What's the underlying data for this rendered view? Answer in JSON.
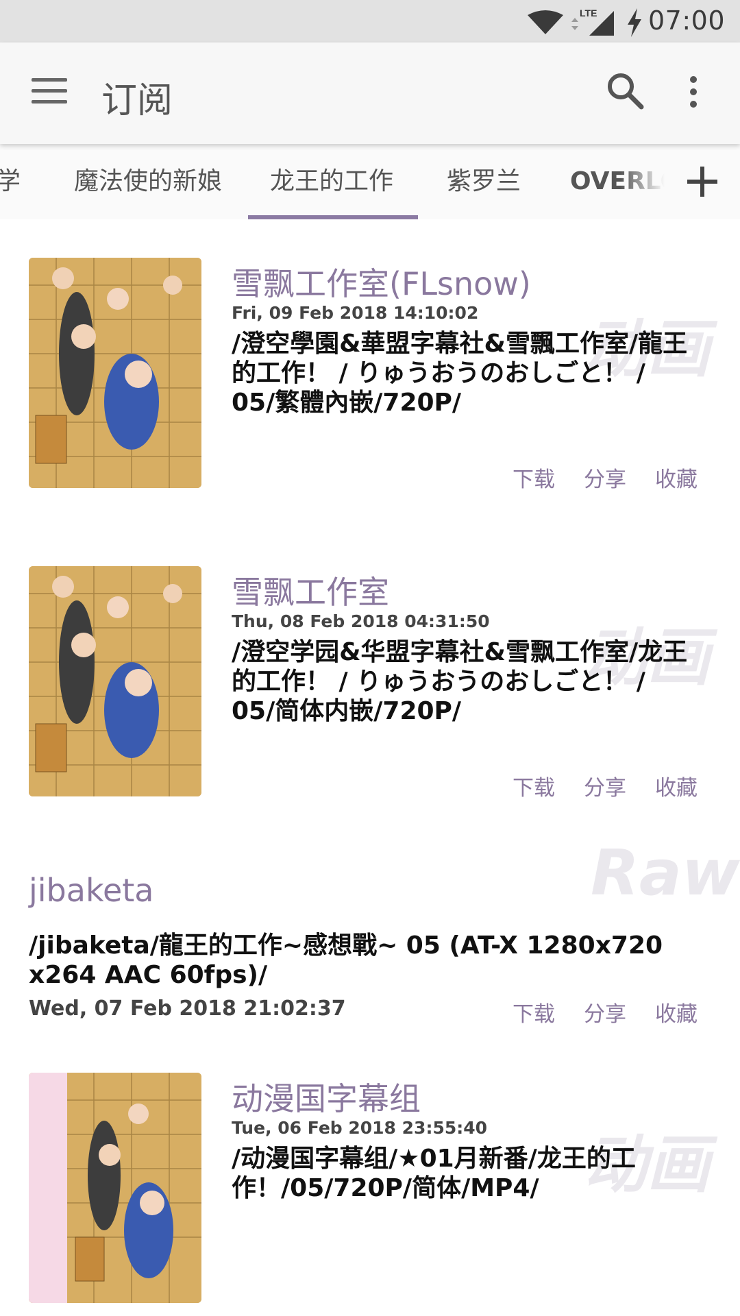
{
  "status_bar": {
    "time": "07:00",
    "network": "LTE"
  },
  "app_bar": {
    "title": "订阅"
  },
  "tabs": [
    {
      "label": "学"
    },
    {
      "label": "魔法使的新娘"
    },
    {
      "label": "龙王的工作"
    },
    {
      "label": "紫罗兰"
    },
    {
      "label": "OVERLO"
    }
  ],
  "active_tab_index": 2,
  "action_labels": {
    "download": "下载",
    "share": "分享",
    "favorite": "收藏"
  },
  "feed": [
    {
      "author": "雪飘工作室(FLsnow)",
      "date": "Fri, 09 Feb 2018 14:10:02",
      "description": "/澄空學園&華盟字幕社&雪飄工作室/龍王的工作！ / りゅうおうのおしごと！ / 05/繁體內嵌/720P/",
      "category": "动画",
      "has_thumbnail": true
    },
    {
      "author": "雪飘工作室",
      "date": "Thu, 08 Feb 2018 04:31:50",
      "description": "/澄空学园&华盟字幕社&雪飘工作室/龙王的工作！ / りゅうおうのおしごと！ / 05/简体内嵌/720P/",
      "category": "动画",
      "has_thumbnail": true
    },
    {
      "author": "jibaketa",
      "date": "Wed, 07 Feb 2018 21:02:37",
      "description": "/jibaketa/龍王的工作~感想戰~ 05 (AT-X 1280x720 x264 AAC 60fps)/",
      "category": "Raw",
      "has_thumbnail": false
    },
    {
      "author": "动漫国字幕组",
      "date": "Tue, 06 Feb 2018 23:55:40",
      "description": "/动漫国字幕组/★01月新番/龙王的工作！/05/720P/简体/MP4/",
      "category": "动画",
      "has_thumbnail": true
    }
  ]
}
